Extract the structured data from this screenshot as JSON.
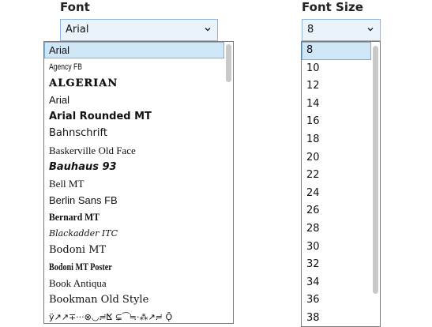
{
  "font": {
    "label": "Font",
    "selected": "Arial",
    "options": [
      {
        "text": "Arial",
        "style": "f-sans",
        "selected": true
      },
      {
        "text": "Agency FB",
        "style": "f-condensed"
      },
      {
        "text": "ALGERIAN",
        "style": "f-algerian"
      },
      {
        "text": "Arial",
        "style": "f-sans"
      },
      {
        "text": "Arial Rounded MT",
        "style": "f-rounded"
      },
      {
        "text": "Bahnschrift",
        "style": "f-bahn"
      },
      {
        "text": "Baskerville Old Face",
        "style": "f-basker"
      },
      {
        "text": "Bauhaus 93",
        "style": "f-bauhaus"
      },
      {
        "text": "Bell MT",
        "style": "f-bell"
      },
      {
        "text": "Berlin Sans FB",
        "style": "f-berlin"
      },
      {
        "text": "Bernard MT",
        "style": "f-bernard"
      },
      {
        "text": "Blackadder ITC",
        "style": "f-black"
      },
      {
        "text": "Bodoni MT",
        "style": "f-bodoni"
      },
      {
        "text": "Bodoni MT Poster",
        "style": "f-bodoni-poster"
      },
      {
        "text": "Book Antiqua",
        "style": "f-antiqua"
      },
      {
        "text": "Bookman Old Style",
        "style": "f-bookman"
      },
      {
        "text": "ÿ↗↗∓···⊗◡≓ⴿ ⊊⁀≒·⁂↗≓ Ǭ",
        "style": "f-symbol"
      }
    ]
  },
  "font_size": {
    "label": "Font Size",
    "selected": "8",
    "options": [
      "8",
      "10",
      "12",
      "14",
      "16",
      "18",
      "20",
      "22",
      "24",
      "26",
      "28",
      "30",
      "32",
      "34",
      "36",
      "38"
    ]
  },
  "icons": {
    "dropdown_arrow": "chevron-down-icon"
  },
  "colors": {
    "combo_bg": "#eaf3fc",
    "combo_border": "#8fb7de",
    "selected_bg": "#cfe6f7",
    "selected_border": "#77b0dd",
    "scroll_thumb": "#c9c9c9"
  }
}
